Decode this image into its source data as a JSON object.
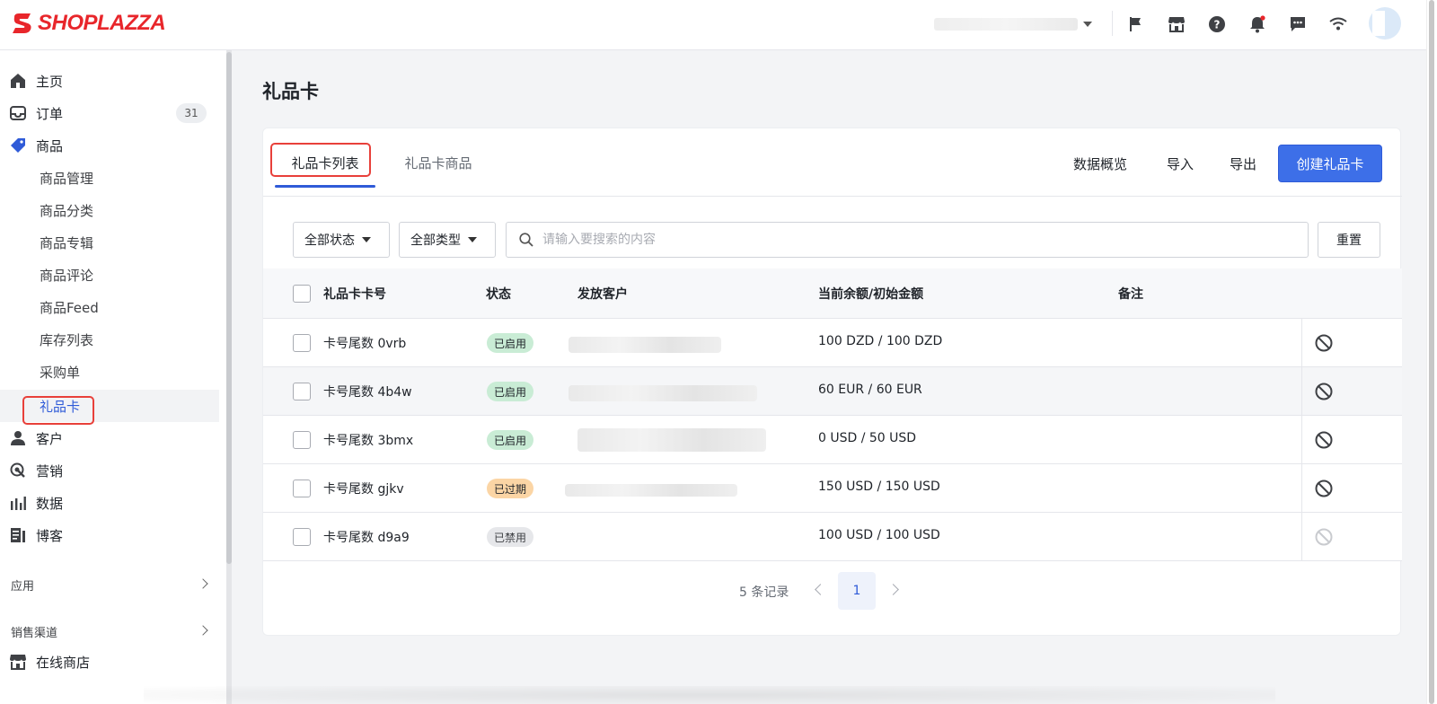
{
  "brand": {
    "name": "SHOPLAZZA",
    "color": "#e8262b"
  },
  "topbar": {
    "icons": [
      "flag-icon",
      "store-icon",
      "help-icon",
      "bell-icon",
      "message-icon",
      "wifi-icon"
    ]
  },
  "sidebar": {
    "items": [
      {
        "label": "主页",
        "icon": "home-icon"
      },
      {
        "label": "订单",
        "icon": "inbox-icon",
        "badge": "31"
      },
      {
        "label": "商品",
        "icon": "tag-icon"
      },
      {
        "label": "商品管理"
      },
      {
        "label": "商品分类"
      },
      {
        "label": "商品专辑"
      },
      {
        "label": "商品评论"
      },
      {
        "label": "商品Feed"
      },
      {
        "label": "库存列表"
      },
      {
        "label": "采购单"
      },
      {
        "label": "礼品卡"
      },
      {
        "label": "客户",
        "icon": "user-icon"
      },
      {
        "label": "营销",
        "icon": "marketing-icon"
      },
      {
        "label": "数据",
        "icon": "bar-chart-icon"
      },
      {
        "label": "博客",
        "icon": "blog-icon"
      }
    ],
    "sections": [
      {
        "label": "应用"
      },
      {
        "label": "销售渠道"
      }
    ],
    "channel_item": {
      "label": "在线商店",
      "icon": "store-icon"
    }
  },
  "page": {
    "title": "礼品卡"
  },
  "tabs": [
    {
      "label": "礼品卡列表",
      "active": true
    },
    {
      "label": "礼品卡商品",
      "active": false
    }
  ],
  "actions": {
    "overview": "数据概览",
    "import": "导入",
    "export": "导出",
    "create": "创建礼品卡",
    "primary_color": "#3d6fe8"
  },
  "filters": {
    "status": "全部状态",
    "type": "全部类型",
    "search_placeholder": "请输入要搜索的内容",
    "reset": "重置"
  },
  "table": {
    "columns": [
      "礼品卡卡号",
      "状态",
      "发放客户",
      "当前余额/初始金额",
      "备注"
    ],
    "rows": [
      {
        "card": "卡号尾数 0vrb",
        "status": "已启用",
        "status_kind": "on",
        "amount": "100 DZD / 100 DZD",
        "note": ""
      },
      {
        "card": "卡号尾数 4b4w",
        "status": "已启用",
        "status_kind": "on",
        "amount": "60 EUR / 60 EUR",
        "note": ""
      },
      {
        "card": "卡号尾数 3bmx",
        "status": "已启用",
        "status_kind": "on",
        "amount": "0 USD / 50 USD",
        "note": ""
      },
      {
        "card": "卡号尾数 gjkv",
        "status": "已过期",
        "status_kind": "expired",
        "amount": "150 USD / 150 USD",
        "note": ""
      },
      {
        "card": "卡号尾数 d9a9",
        "status": "已禁用",
        "status_kind": "disabled",
        "amount": "100 USD / 100 USD",
        "note": ""
      }
    ]
  },
  "pagination": {
    "summary": "5 条记录",
    "current_page": "1"
  },
  "status_colors": {
    "on": "#c9ecd5",
    "expired": "#fbd5a5",
    "disabled": "#e6e7ea"
  }
}
